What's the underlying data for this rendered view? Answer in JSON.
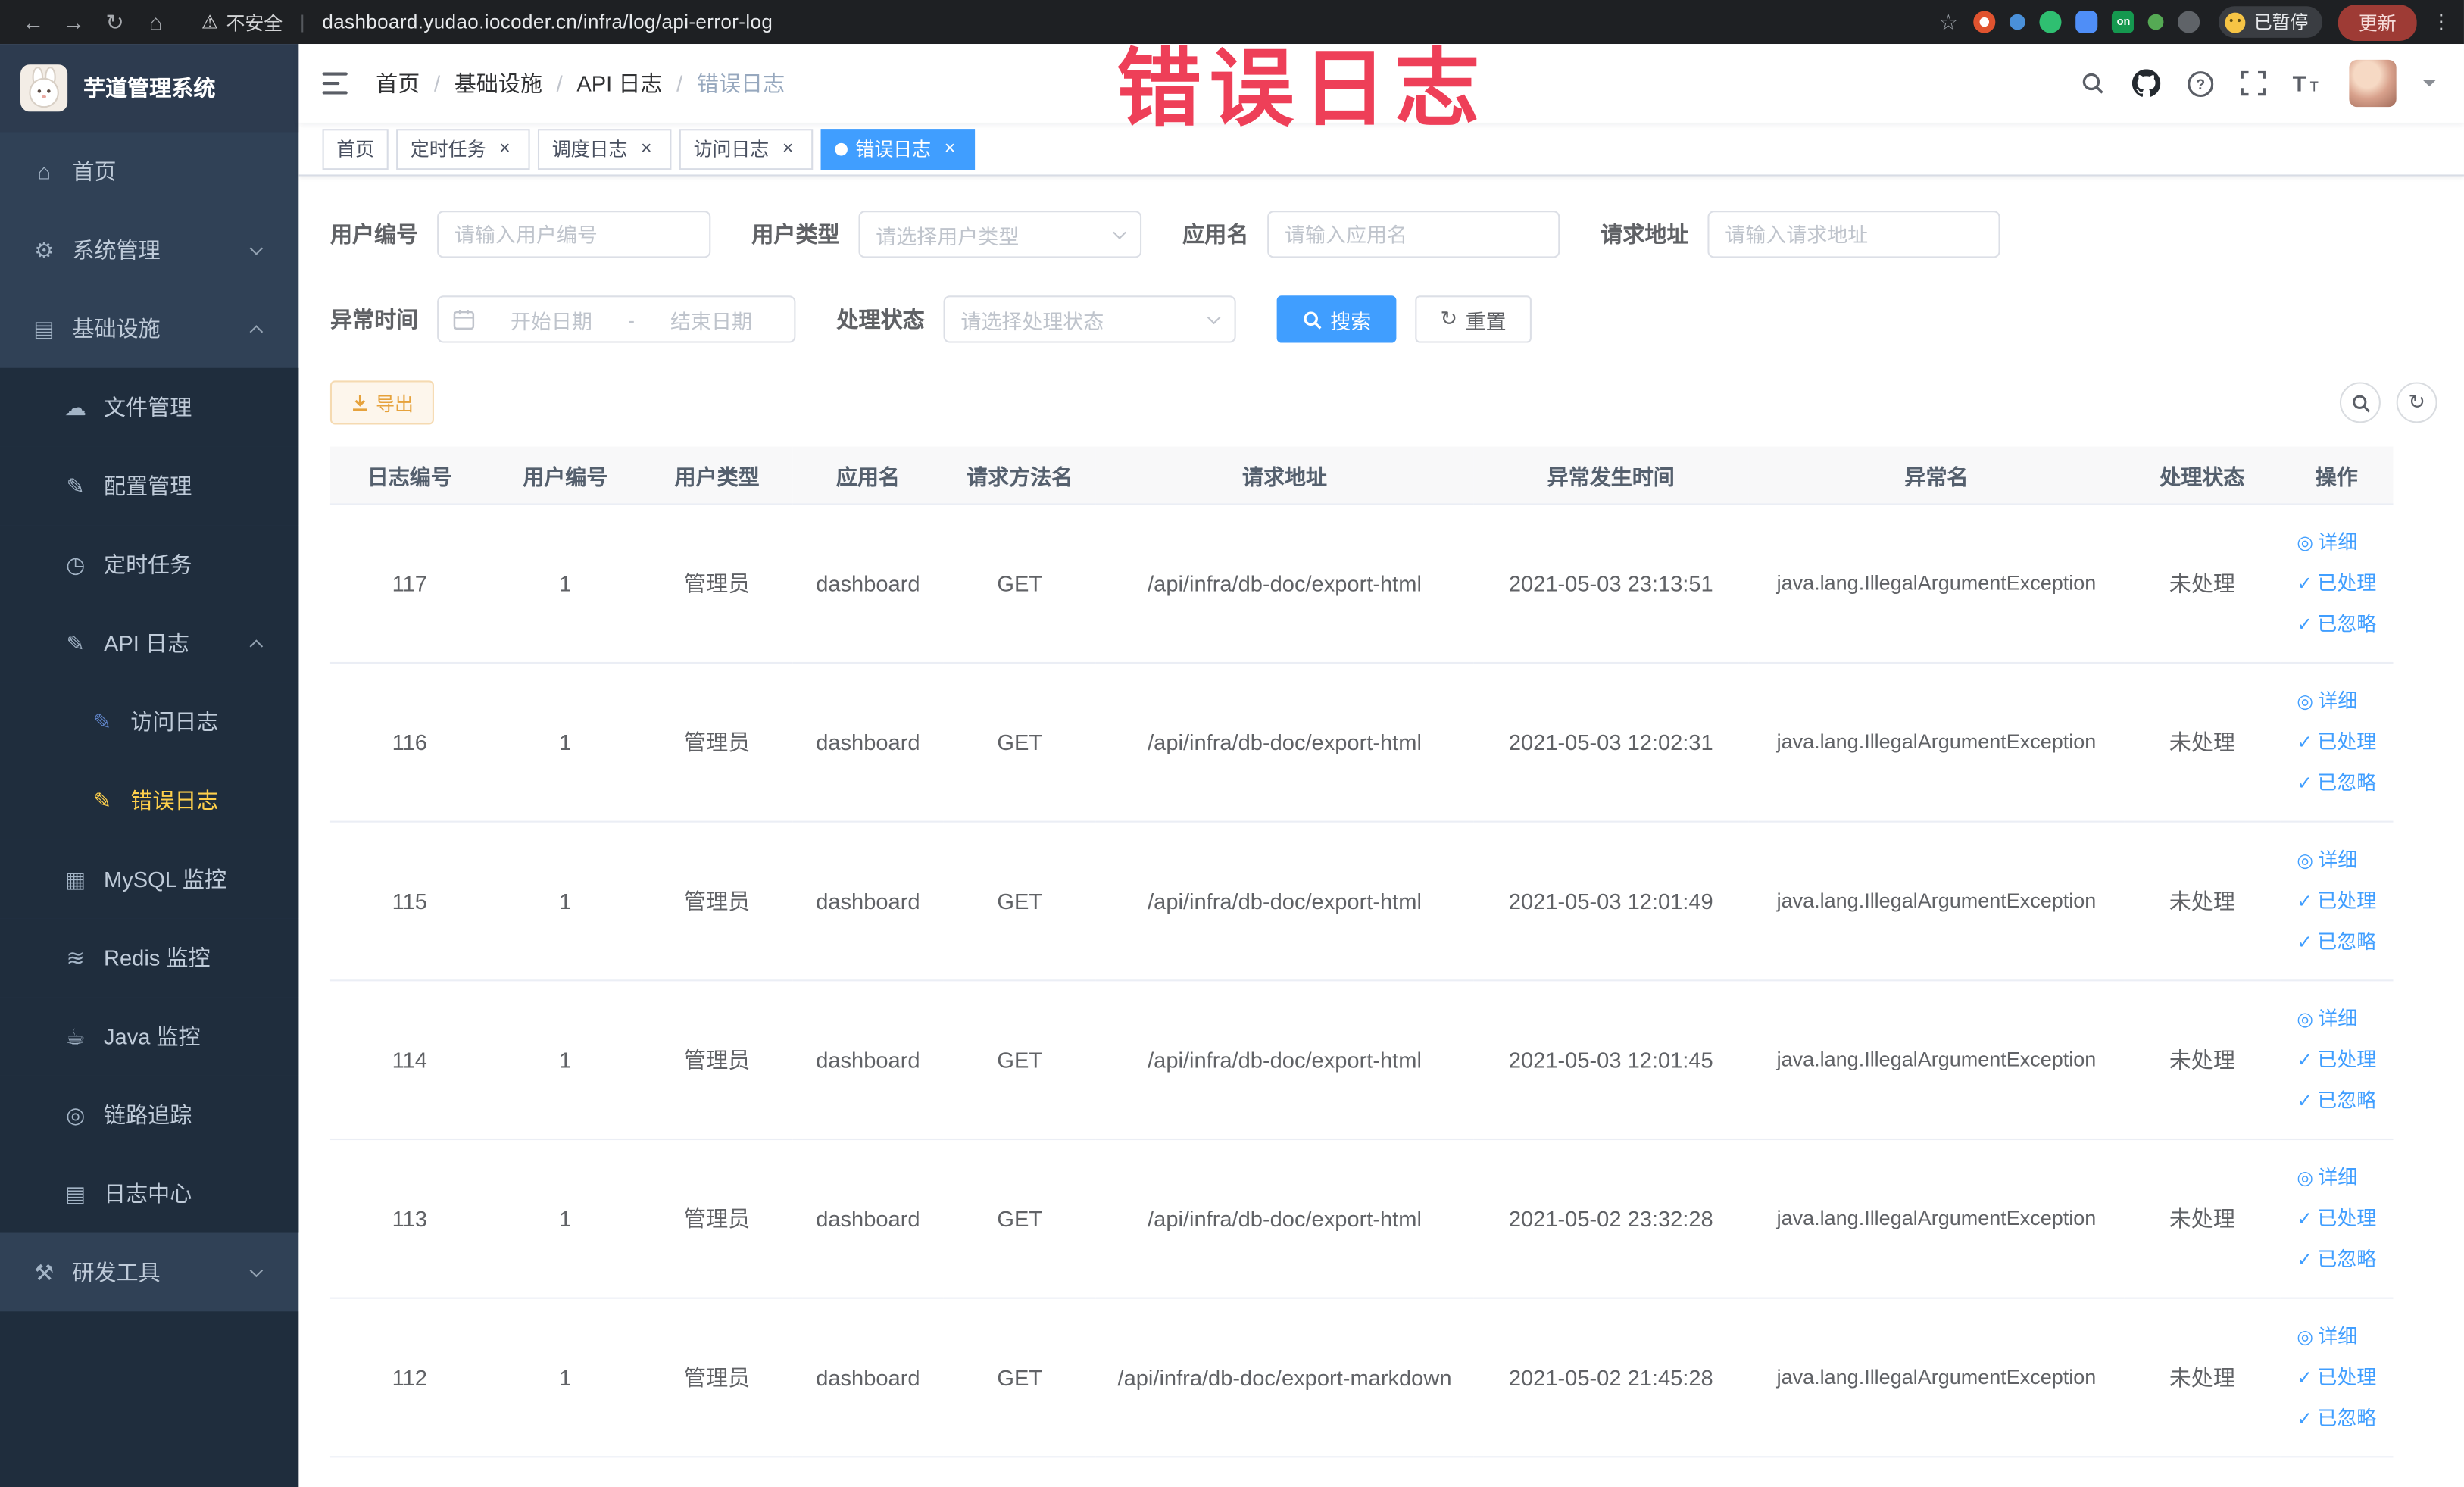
{
  "chrome": {
    "security_label": "不安全",
    "url": "dashboard.yudao.iocoder.cn/infra/log/api-error-log",
    "paused_label": "已暂停",
    "update_label": "更新",
    "extensions": [
      {
        "icon": "extension-icon",
        "shape": "ring",
        "color": "#e0532f"
      },
      {
        "icon": "extension-icon",
        "shape": "dot",
        "color": "#4a90d9"
      },
      {
        "icon": "extension-icon",
        "shape": "circle",
        "color": "#2fbf71"
      },
      {
        "icon": "extension-icon",
        "shape": "square",
        "color": "#4f8ef7"
      },
      {
        "icon": "extension-icon",
        "shape": "badge",
        "color": "#15984f",
        "label": "on"
      },
      {
        "icon": "extension-icon",
        "shape": "dot",
        "color": "#55a954"
      },
      {
        "icon": "extension-icon",
        "shape": "circle",
        "color": "#5f6368"
      }
    ]
  },
  "annotation": "错误日志",
  "sidebar": {
    "logo_title": "芋道管理系统",
    "items": [
      {
        "id": "home",
        "label": "首页",
        "icon": "home-icon",
        "glyph": "⌂",
        "depth": 0
      },
      {
        "id": "system-management",
        "label": "系统管理",
        "icon": "gear-icon",
        "glyph": "⚙",
        "depth": 0,
        "chevron": "down"
      },
      {
        "id": "infrastructure",
        "label": "基础设施",
        "icon": "grid-icon",
        "glyph": "▤",
        "depth": 0,
        "chevron": "up"
      },
      {
        "id": "file-management",
        "label": "文件管理",
        "icon": "cloud-icon",
        "glyph": "☁",
        "depth": 1
      },
      {
        "id": "config-management",
        "label": "配置管理",
        "icon": "edit-icon",
        "glyph": "✎",
        "depth": 1
      },
      {
        "id": "scheduled-tasks",
        "label": "定时任务",
        "icon": "timer-icon",
        "glyph": "◷",
        "depth": 1
      },
      {
        "id": "api-log",
        "label": "API 日志",
        "icon": "log-icon",
        "glyph": "✎",
        "depth": 1,
        "chevron": "up"
      },
      {
        "id": "access-log",
        "label": "访问日志",
        "icon": "doc-icon",
        "glyph": "✎",
        "depth": 2
      },
      {
        "id": "error-log",
        "label": "错误日志",
        "icon": "doc-icon",
        "glyph": "✎",
        "depth": 2,
        "active": true
      },
      {
        "id": "mysql-monitor",
        "label": "MySQL 监控",
        "icon": "db-icon",
        "glyph": "▦",
        "depth": 1
      },
      {
        "id": "redis-monitor",
        "label": "Redis 监控",
        "icon": "stack-icon",
        "glyph": "≋",
        "depth": 1
      },
      {
        "id": "java-monitor",
        "label": "Java 监控",
        "icon": "coffee-icon",
        "glyph": "☕",
        "depth": 1
      },
      {
        "id": "trace",
        "label": "链路追踪",
        "icon": "target-icon",
        "glyph": "◎",
        "depth": 1
      },
      {
        "id": "log-center",
        "label": "日志中心",
        "icon": "doc-icon",
        "glyph": "▤",
        "depth": 1
      },
      {
        "id": "dev-tools",
        "label": "研发工具",
        "icon": "tools-icon",
        "glyph": "⚒",
        "depth": 0,
        "chevron": "down"
      }
    ]
  },
  "navbar": {
    "breadcrumb": [
      "首页",
      "基础设施",
      "API 日志",
      "错误日志"
    ]
  },
  "tabs": [
    {
      "id": "home",
      "label": "首页",
      "closable": false,
      "active": false
    },
    {
      "id": "scheduled-tasks",
      "label": "定时任务",
      "closable": true,
      "active": false
    },
    {
      "id": "schedule-log",
      "label": "调度日志",
      "closable": true,
      "active": false
    },
    {
      "id": "access-log",
      "label": "访问日志",
      "closable": true,
      "active": false
    },
    {
      "id": "error-log",
      "label": "错误日志",
      "closable": true,
      "active": true
    }
  ],
  "filters": {
    "user_id": {
      "label": "用户编号",
      "placeholder": "请输入用户编号"
    },
    "user_type": {
      "label": "用户类型",
      "placeholder": "请选择用户类型"
    },
    "app_name": {
      "label": "应用名",
      "placeholder": "请输入应用名"
    },
    "request_url": {
      "label": "请求地址",
      "placeholder": "请输入请求地址"
    },
    "exception_time": {
      "label": "异常时间",
      "start_placeholder": "开始日期",
      "separator": "-",
      "end_placeholder": "结束日期"
    },
    "status": {
      "label": "处理状态",
      "placeholder": "请选择处理状态"
    },
    "search_label": "搜索",
    "reset_label": "重置"
  },
  "toolbar": {
    "export_label": "导出"
  },
  "table": {
    "columns": [
      "日志编号",
      "用户编号",
      "用户类型",
      "应用名",
      "请求方法名",
      "请求地址",
      "异常发生时间",
      "异常名",
      "处理状态",
      "操作"
    ],
    "rows": [
      [
        "117",
        "1",
        "管理员",
        "dashboard",
        "GET",
        "/api/infra/db-doc/export-html",
        "2021-05-03 23:13:51",
        "java.lang.IllegalArgumentException",
        "未处理"
      ],
      [
        "116",
        "1",
        "管理员",
        "dashboard",
        "GET",
        "/api/infra/db-doc/export-html",
        "2021-05-03 12:02:31",
        "java.lang.IllegalArgumentException",
        "未处理"
      ],
      [
        "115",
        "1",
        "管理员",
        "dashboard",
        "GET",
        "/api/infra/db-doc/export-html",
        "2021-05-03 12:01:49",
        "java.lang.IllegalArgumentException",
        "未处理"
      ],
      [
        "114",
        "1",
        "管理员",
        "dashboard",
        "GET",
        "/api/infra/db-doc/export-html",
        "2021-05-03 12:01:45",
        "java.lang.IllegalArgumentException",
        "未处理"
      ],
      [
        "113",
        "1",
        "管理员",
        "dashboard",
        "GET",
        "/api/infra/db-doc/export-html",
        "2021-05-02 23:32:28",
        "java.lang.IllegalArgumentException",
        "未处理"
      ],
      [
        "112",
        "1",
        "管理员",
        "dashboard",
        "GET",
        "/api/infra/db-doc/export-markdown",
        "2021-05-02 21:45:28",
        "java.lang.IllegalArgumentException",
        "未处理"
      ]
    ],
    "row_actions": [
      "详细",
      "已处理",
      "已忽略"
    ]
  },
  "colors": {
    "primary": "#409eff",
    "sidebar_bg": "#304156",
    "submenu_bg": "#1f2d3d",
    "active_menu_text": "#ffd04b",
    "warning": "#e6a23c",
    "annotation_red": "#ee3f58"
  }
}
